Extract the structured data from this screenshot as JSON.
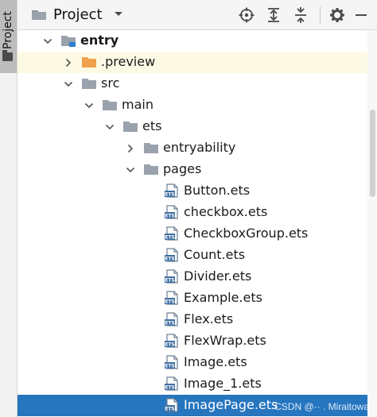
{
  "sidebar": {
    "tab_label": "Project",
    "icon": "folder-icon"
  },
  "header": {
    "title": "Project",
    "dropdown_icon": "chevron-down-icon",
    "actions": [
      "locate-icon",
      "expand-all-icon",
      "collapse-all-icon",
      "gear-icon",
      "minimize-icon"
    ]
  },
  "tree": {
    "items": [
      {
        "label": "entry",
        "level": 0,
        "expanded": true,
        "kind": "module",
        "bold": true
      },
      {
        "label": ".preview",
        "level": 1,
        "expanded": false,
        "kind": "folder-orange",
        "highlight": true
      },
      {
        "label": "src",
        "level": 1,
        "expanded": true,
        "kind": "folder"
      },
      {
        "label": "main",
        "level": 2,
        "expanded": true,
        "kind": "folder"
      },
      {
        "label": "ets",
        "level": 3,
        "expanded": true,
        "kind": "folder"
      },
      {
        "label": "entryability",
        "level": 4,
        "expanded": false,
        "kind": "folder"
      },
      {
        "label": "pages",
        "level": 4,
        "expanded": true,
        "kind": "folder"
      },
      {
        "label": "Button.ets",
        "level": 5,
        "kind": "ets-file"
      },
      {
        "label": "checkbox.ets",
        "level": 5,
        "kind": "ets-file"
      },
      {
        "label": "CheckboxGroup.ets",
        "level": 5,
        "kind": "ets-file"
      },
      {
        "label": "Count.ets",
        "level": 5,
        "kind": "ets-file"
      },
      {
        "label": "Divider.ets",
        "level": 5,
        "kind": "ets-file"
      },
      {
        "label": "Example.ets",
        "level": 5,
        "kind": "ets-file"
      },
      {
        "label": "Flex.ets",
        "level": 5,
        "kind": "ets-file"
      },
      {
        "label": "FlexWrap.ets",
        "level": 5,
        "kind": "ets-file"
      },
      {
        "label": "Image.ets",
        "level": 5,
        "kind": "ets-file"
      },
      {
        "label": "Image_1.ets",
        "level": 5,
        "kind": "ets-file"
      },
      {
        "label": "ImagePage.ets",
        "level": 5,
        "kind": "ets-file",
        "selected": true
      }
    ]
  },
  "watermark": "CSDN @·· . Miraitowa",
  "colors": {
    "selection": "#2675bf",
    "highlight": "#fcfae4",
    "folder": "#9aa3ad",
    "folder_orange": "#f0a04b",
    "ets_icon": "#3f6fa1"
  }
}
